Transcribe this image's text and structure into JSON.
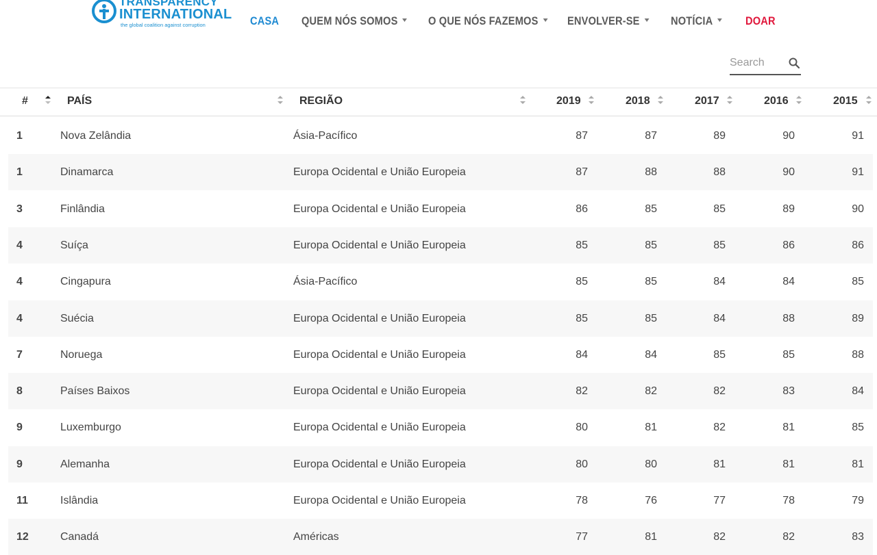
{
  "brand": {
    "name_line1": "TRANSPARENCY",
    "name_line2": "INTERNATIONAL",
    "tagline": "the global coalition against corruption",
    "color": "#1a8fd0"
  },
  "nav": {
    "items": [
      {
        "label": "CASA",
        "state": "active"
      },
      {
        "label": "QUEM NÓS SOMOS",
        "dropdown": true
      },
      {
        "label": "O QUE NÓS FAZEMOS",
        "dropdown": true
      },
      {
        "label": "ENVOLVER-SE",
        "dropdown": true
      },
      {
        "label": "NOTÍCIA",
        "dropdown": true
      },
      {
        "label": "DOAR",
        "color": "#e0183c"
      }
    ],
    "active_color": "#1f8ad2"
  },
  "search": {
    "placeholder": "Search",
    "value": ""
  },
  "table": {
    "headers": {
      "rank": "#",
      "country": "PAÍS",
      "region": "REGIÃO",
      "years": [
        "2019",
        "2018",
        "2017",
        "2016",
        "2015"
      ]
    },
    "sorted_column": "country",
    "rows": [
      {
        "rank": "1",
        "country": "Nova Zelândia",
        "region": "Ásia-Pacífico",
        "scores": [
          "87",
          "87",
          "89",
          "90",
          "91"
        ]
      },
      {
        "rank": "1",
        "country": "Dinamarca",
        "region": "Europa Ocidental e União Europeia",
        "scores": [
          "87",
          "88",
          "88",
          "90",
          "91"
        ]
      },
      {
        "rank": "3",
        "country": "Finlândia",
        "region": "Europa Ocidental e União Europeia",
        "scores": [
          "86",
          "85",
          "85",
          "89",
          "90"
        ]
      },
      {
        "rank": "4",
        "country": "Suíça",
        "region": "Europa Ocidental e União Europeia",
        "scores": [
          "85",
          "85",
          "85",
          "86",
          "86"
        ]
      },
      {
        "rank": "4",
        "country": "Cingapura",
        "region": "Ásia-Pacífico",
        "scores": [
          "85",
          "85",
          "84",
          "84",
          "85"
        ]
      },
      {
        "rank": "4",
        "country": "Suécia",
        "region": "Europa Ocidental e União Europeia",
        "scores": [
          "85",
          "85",
          "84",
          "88",
          "89"
        ]
      },
      {
        "rank": "7",
        "country": "Noruega",
        "region": "Europa Ocidental e União Europeia",
        "scores": [
          "84",
          "84",
          "85",
          "85",
          "88"
        ]
      },
      {
        "rank": "8",
        "country": "Países Baixos",
        "region": "Europa Ocidental e União Europeia",
        "scores": [
          "82",
          "82",
          "82",
          "83",
          "84"
        ]
      },
      {
        "rank": "9",
        "country": "Luxemburgo",
        "region": "Europa Ocidental e União Europeia",
        "scores": [
          "80",
          "81",
          "82",
          "81",
          "85"
        ]
      },
      {
        "rank": "9",
        "country": "Alemanha",
        "region": "Europa Ocidental e União Europeia",
        "scores": [
          "80",
          "80",
          "81",
          "81",
          "81"
        ]
      },
      {
        "rank": "11",
        "country": "Islândia",
        "region": "Europa Ocidental e União Europeia",
        "scores": [
          "78",
          "76",
          "77",
          "78",
          "79"
        ]
      },
      {
        "rank": "12",
        "country": "Canadá",
        "region": "Américas",
        "scores": [
          "77",
          "81",
          "82",
          "82",
          "83"
        ]
      }
    ]
  }
}
